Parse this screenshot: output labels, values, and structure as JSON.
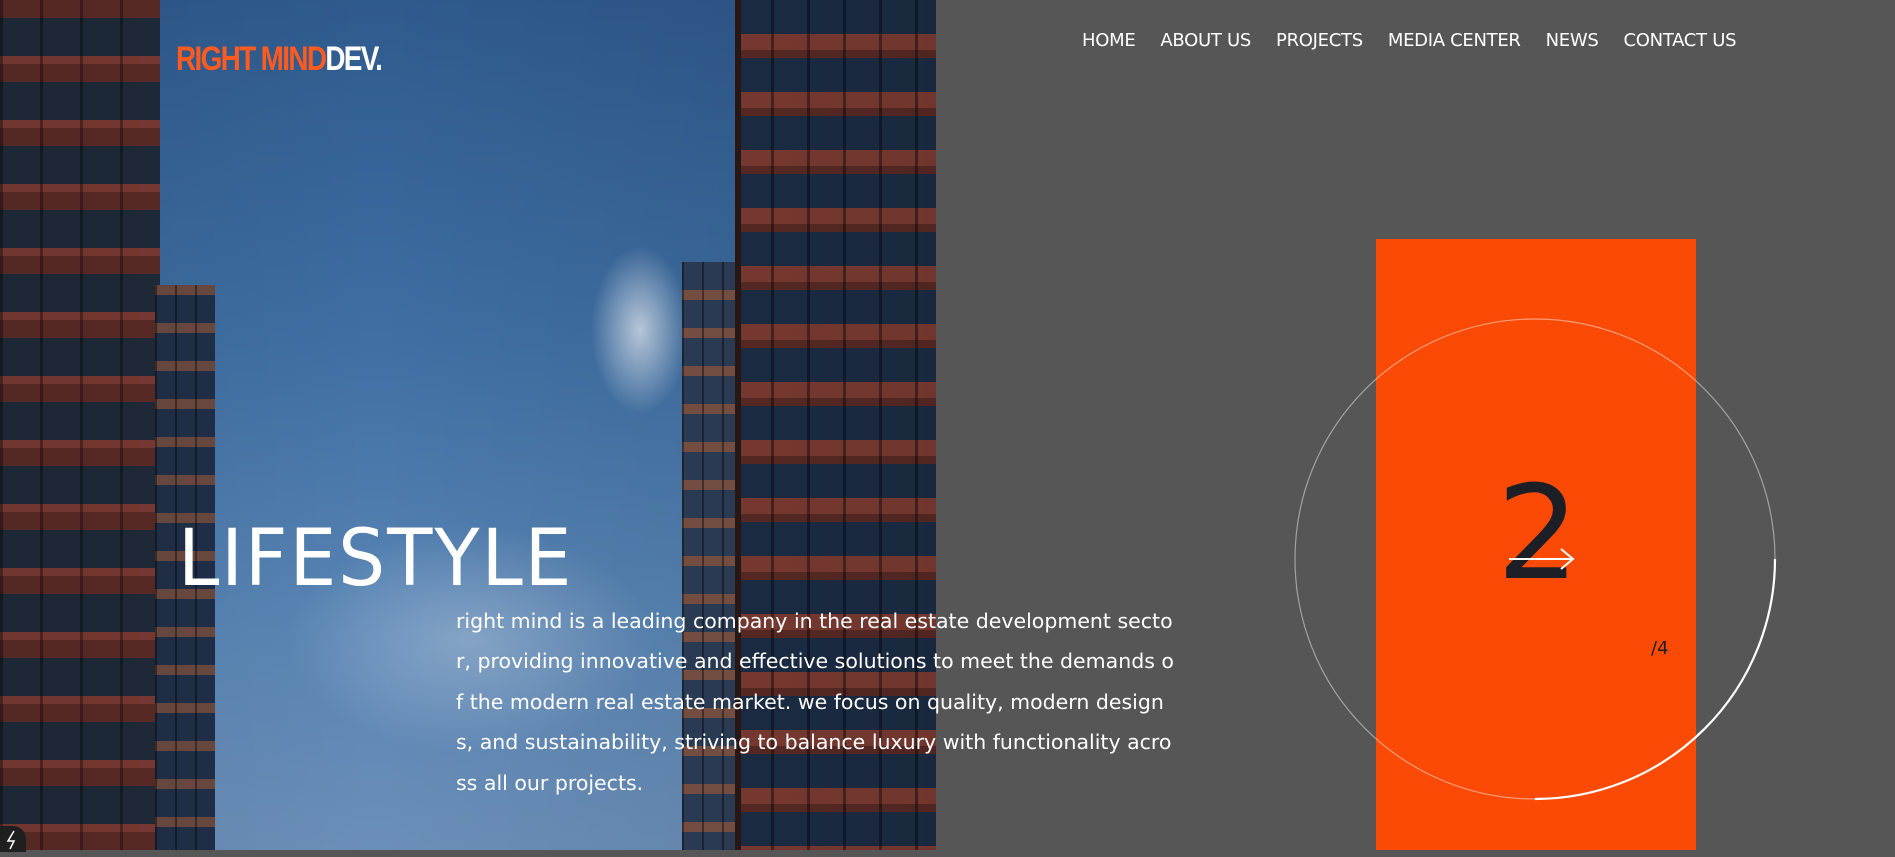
{
  "brand": {
    "name_part1": "RIGHT MIND",
    "name_part2": "DEV.",
    "accent_color": "#fa4a05"
  },
  "nav": {
    "items": [
      {
        "label": "HOME"
      },
      {
        "label": "ABOUT US"
      },
      {
        "label": "PROJECTS"
      },
      {
        "label": "MEDIA CENTER"
      },
      {
        "label": "NEWS"
      },
      {
        "label": "CONTACT US"
      }
    ]
  },
  "hero": {
    "headline": "LIFESTYLE",
    "description": "right mind is a leading company in the real estate development sector, providing innovative and effective solutions to meet the demands of the modern real estate market. we focus on quality, modern designs, and sustainability, striving to balance luxury with functionality across all our projects."
  },
  "slider": {
    "current": "2",
    "total_label": "/4",
    "progress": 0.5,
    "next_icon": "arrow-right-icon"
  },
  "corner_icon": "bolt-icon"
}
